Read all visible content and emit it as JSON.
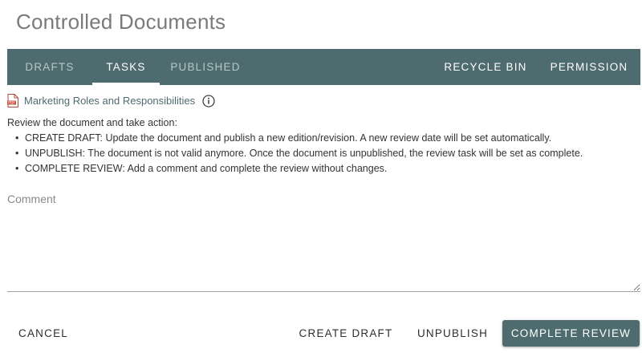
{
  "page": {
    "title": "Controlled Documents"
  },
  "tabs_left": [
    {
      "label": "DRAFTS",
      "active": false
    },
    {
      "label": "TASKS",
      "active": true
    },
    {
      "label": "PUBLISHED",
      "active": false
    }
  ],
  "tabs_right": [
    {
      "label": "RECYCLE BIN"
    },
    {
      "label": "PERMISSION"
    }
  ],
  "document": {
    "name": "Marketing Roles and Responsibilities",
    "icon": "pdf-file-icon",
    "info_icon": "info-icon"
  },
  "instructions": {
    "intro": "Review the document and take action:",
    "items": [
      "CREATE DRAFT: Update the document and publish a new edition/revision. A new review date will be set automatically.",
      "UNPUBLISH: The document is not valid anymore. Once the document is unpublished, the review task will be set as complete.",
      "COMPLETE REVIEW: Add a comment and complete the review without changes."
    ]
  },
  "comment": {
    "placeholder": "Comment",
    "value": ""
  },
  "actions": {
    "cancel": "CANCEL",
    "create_draft": "CREATE DRAFT",
    "unpublish": "UNPUBLISH",
    "complete_review": "COMPLETE REVIEW"
  },
  "colors": {
    "accent": "#4e6b6f",
    "tab_inactive_text": "#b7c7c8",
    "page_background": "#ffffff"
  }
}
